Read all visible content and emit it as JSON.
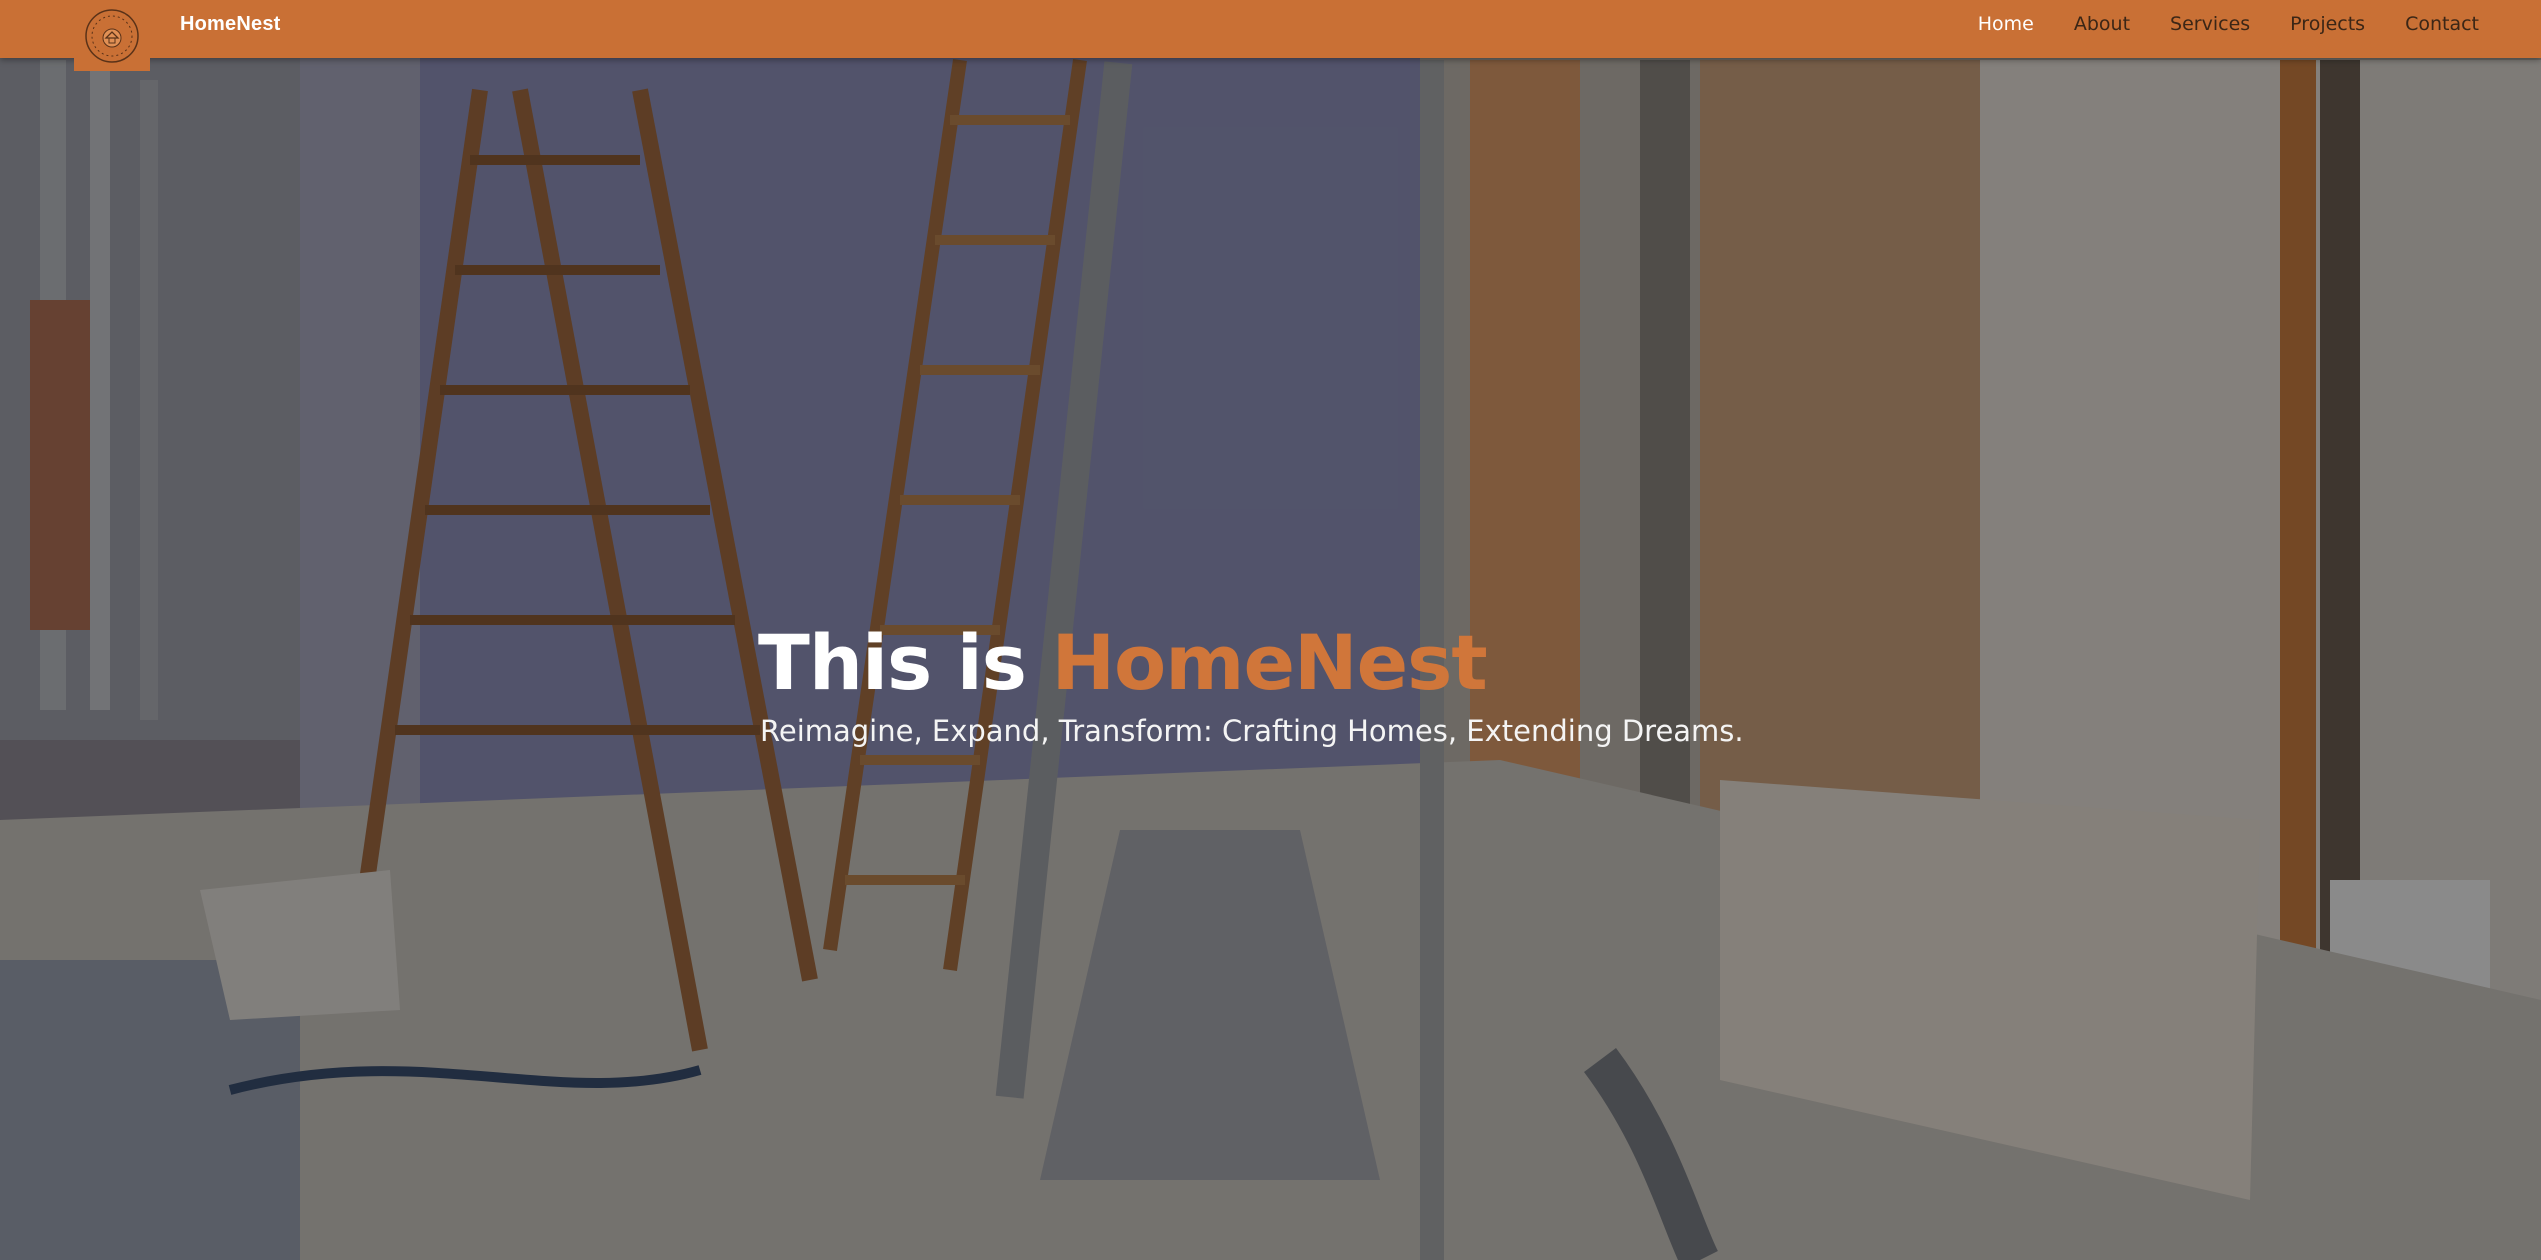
{
  "brand": {
    "name": "HomeNest",
    "logo_icon": "house-seal-logo-icon"
  },
  "nav": {
    "items": [
      {
        "label": "Home",
        "active": true
      },
      {
        "label": "About",
        "active": false
      },
      {
        "label": "Services",
        "active": false
      },
      {
        "label": "Projects",
        "active": false
      },
      {
        "label": "Contact",
        "active": false
      }
    ]
  },
  "hero": {
    "title_prefix": "This is ",
    "title_accent": "HomeNest",
    "subtitle": "Reimagine, Expand, Transform: Crafting Homes, Extending Dreams.",
    "background": "renovation-interior-photo"
  },
  "colors": {
    "accent": "#c97035",
    "accent_text": "#d0763a",
    "nav_text": "#3b2616",
    "nav_active": "#ffffff",
    "hero_text": "#ffffff"
  }
}
